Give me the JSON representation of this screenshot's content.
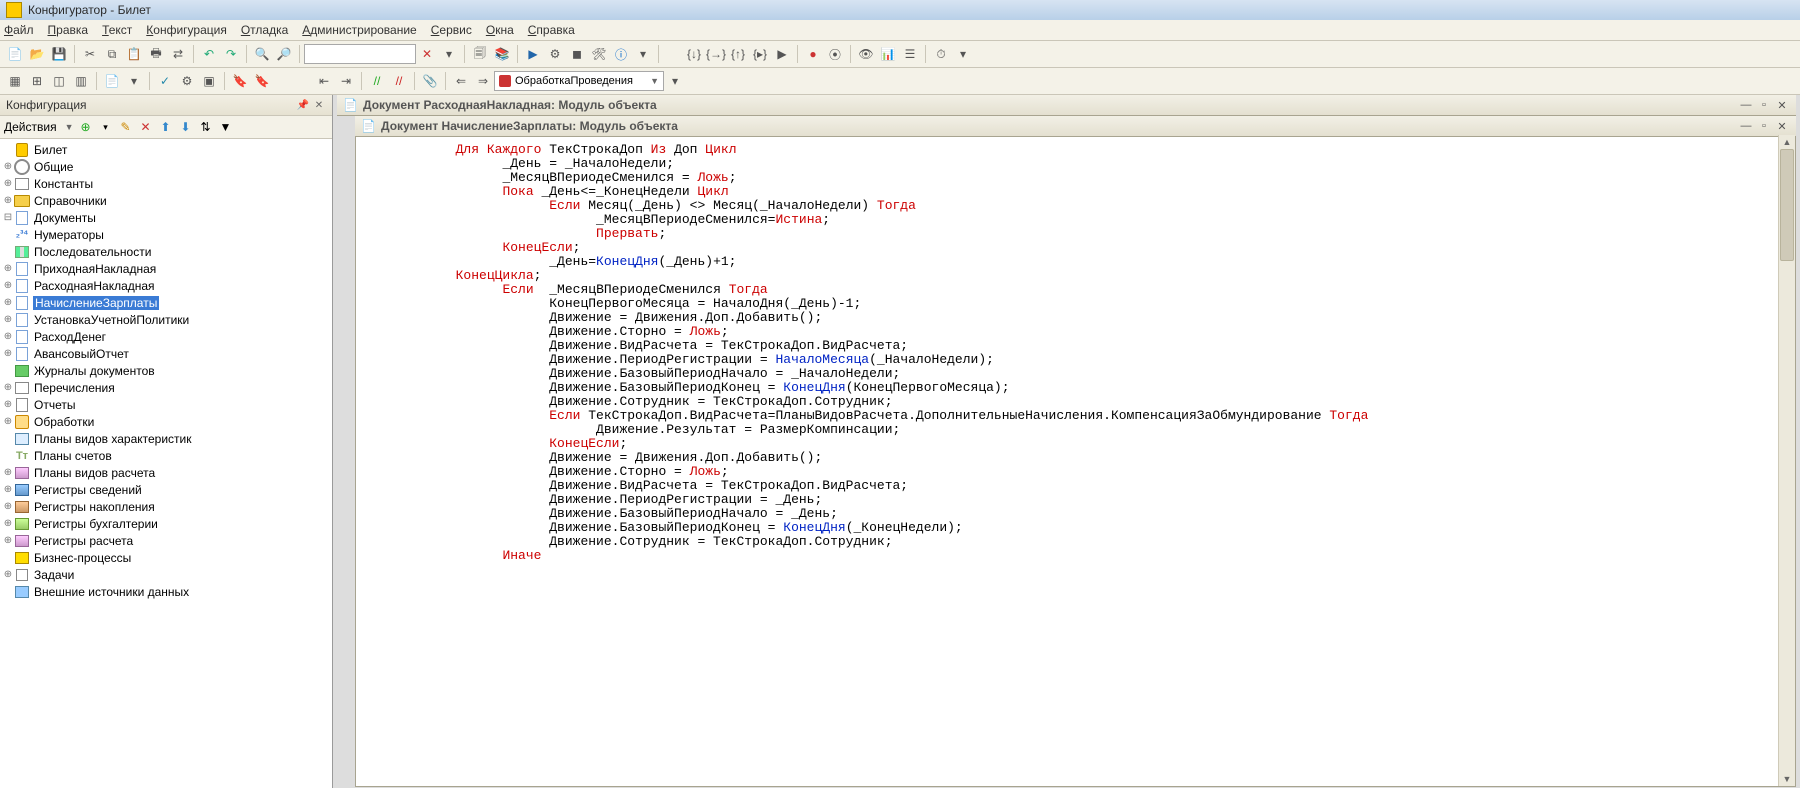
{
  "title": "Конфигуратор - Билет",
  "menu": [
    "Файл",
    "Правка",
    "Текст",
    "Конфигурация",
    "Отладка",
    "Администрирование",
    "Сервис",
    "Окна",
    "Справка"
  ],
  "toolbar2": {
    "combo": "ОбработкаПроведения"
  },
  "side": {
    "header": "Конфигурация",
    "actions": "Действия",
    "tree": [
      {
        "ind": 0,
        "tw": "",
        "ic": "db",
        "lbl": "Билет"
      },
      {
        "ind": 0,
        "tw": "⊕",
        "ic": "gear",
        "lbl": "Общие"
      },
      {
        "ind": 0,
        "tw": "⊕",
        "ic": "enum",
        "lbl": "Константы"
      },
      {
        "ind": 0,
        "tw": "⊕",
        "ic": "folder",
        "lbl": "Справочники"
      },
      {
        "ind": 0,
        "tw": "⊟",
        "ic": "doc",
        "lbl": "Документы"
      },
      {
        "ind": 1,
        "tw": "",
        "ic": "num",
        "lbl": "Нумераторы"
      },
      {
        "ind": 1,
        "tw": "",
        "ic": "seq",
        "lbl": "Последовательности"
      },
      {
        "ind": 1,
        "tw": "⊕",
        "ic": "doc",
        "lbl": "ПриходнаяНакладная"
      },
      {
        "ind": 1,
        "tw": "⊕",
        "ic": "doc",
        "lbl": "РасходнаяНакладная"
      },
      {
        "ind": 1,
        "tw": "⊕",
        "ic": "doc",
        "lbl": "НачислениеЗарплаты",
        "sel": true
      },
      {
        "ind": 1,
        "tw": "⊕",
        "ic": "doc",
        "lbl": "УстановкаУчетнойПолитики"
      },
      {
        "ind": 1,
        "tw": "⊕",
        "ic": "doc",
        "lbl": "РасходДенег"
      },
      {
        "ind": 1,
        "tw": "⊕",
        "ic": "doc",
        "lbl": "АвансовыйОтчет"
      },
      {
        "ind": 0,
        "tw": "",
        "ic": "journal",
        "lbl": "Журналы документов"
      },
      {
        "ind": 0,
        "tw": "⊕",
        "ic": "enum",
        "lbl": "Перечисления"
      },
      {
        "ind": 0,
        "tw": "⊕",
        "ic": "report",
        "lbl": "Отчеты"
      },
      {
        "ind": 0,
        "tw": "⊕",
        "ic": "proc",
        "lbl": "Обработки"
      },
      {
        "ind": 0,
        "tw": "",
        "ic": "plan",
        "lbl": "Планы видов характеристик"
      },
      {
        "ind": 0,
        "tw": "",
        "ic": "acc",
        "lbl": "Планы счетов"
      },
      {
        "ind": 0,
        "tw": "⊕",
        "ic": "regc",
        "lbl": "Планы видов расчета"
      },
      {
        "ind": 0,
        "tw": "⊕",
        "ic": "reg",
        "lbl": "Регистры сведений"
      },
      {
        "ind": 0,
        "tw": "⊕",
        "ic": "rega",
        "lbl": "Регистры накопления"
      },
      {
        "ind": 0,
        "tw": "⊕",
        "ic": "regb",
        "lbl": "Регистры бухгалтерии"
      },
      {
        "ind": 0,
        "tw": "⊕",
        "ic": "regc",
        "lbl": "Регистры расчета"
      },
      {
        "ind": 0,
        "tw": "",
        "ic": "bp",
        "lbl": "Бизнес-процессы"
      },
      {
        "ind": 0,
        "tw": "⊕",
        "ic": "task",
        "lbl": "Задачи"
      },
      {
        "ind": 0,
        "tw": "",
        "ic": "ext",
        "lbl": "Внешние источники данных"
      }
    ]
  },
  "doc1": "Документ РасходнаяНакладная: Модуль объекта",
  "doc2": "Документ НачислениеЗарплаты: Модуль объекта",
  "code": [
    {
      "ind": 2,
      "seg": [
        [
          "red",
          "Для Каждого"
        ],
        [
          "black",
          " ТекСтрокаДоп "
        ],
        [
          "red",
          "Из"
        ],
        [
          "black",
          " Доп "
        ],
        [
          "red",
          "Цикл"
        ]
      ]
    },
    {
      "ind": 0,
      "seg": [
        [
          "black",
          ""
        ]
      ]
    },
    {
      "ind": 3,
      "seg": [
        [
          "black",
          "_День = _НачалоНедели;"
        ]
      ]
    },
    {
      "ind": 3,
      "seg": [
        [
          "black",
          "_МесяцВПериодеСменился = "
        ],
        [
          "red",
          "Ложь"
        ],
        [
          "black",
          ";"
        ]
      ]
    },
    {
      "ind": 0,
      "seg": [
        [
          "black",
          ""
        ]
      ]
    },
    {
      "ind": 3,
      "seg": [
        [
          "red",
          "Пока"
        ],
        [
          "black",
          " _День<=_КонецНедели "
        ],
        [
          "red",
          "Цикл"
        ]
      ]
    },
    {
      "ind": 4,
      "seg": [
        [
          "red",
          "Если"
        ],
        [
          "black",
          " Месяц(_День) <> Месяц(_НачалоНедели) "
        ],
        [
          "red",
          "Тогда"
        ]
      ]
    },
    {
      "ind": 5,
      "seg": [
        [
          "black",
          "_МесяцВПериодеСменился="
        ],
        [
          "red",
          "Истина"
        ],
        [
          "black",
          ";"
        ]
      ]
    },
    {
      "ind": 5,
      "seg": [
        [
          "red",
          "Прервать"
        ],
        [
          "black",
          ";"
        ]
      ]
    },
    {
      "ind": 3,
      "seg": [
        [
          "red",
          "КонецЕсли"
        ],
        [
          "black",
          ";"
        ]
      ]
    },
    {
      "ind": 4,
      "seg": [
        [
          "black",
          "_День="
        ],
        [
          "blue",
          "КонецДня"
        ],
        [
          "black",
          "(_День)+1;"
        ]
      ]
    },
    {
      "ind": 2,
      "seg": [
        [
          "red",
          "КонецЦикла"
        ],
        [
          "black",
          ";"
        ]
      ]
    },
    {
      "ind": 0,
      "seg": [
        [
          "black",
          ""
        ]
      ]
    },
    {
      "ind": 0,
      "seg": [
        [
          "black",
          ""
        ]
      ]
    },
    {
      "ind": 3,
      "seg": [
        [
          "red",
          "Если"
        ],
        [
          "black",
          "  _МесяцВПериодеСменился "
        ],
        [
          "red",
          "Тогда"
        ]
      ]
    },
    {
      "ind": 0,
      "seg": [
        [
          "black",
          ""
        ]
      ]
    },
    {
      "ind": 4,
      "seg": [
        [
          "black",
          "КонецПервогоМесяца = НачалоДня(_День)-1;"
        ]
      ]
    },
    {
      "ind": 0,
      "seg": [
        [
          "black",
          ""
        ]
      ]
    },
    {
      "ind": 4,
      "seg": [
        [
          "black",
          "Движение = Движения.Доп.Добавить();"
        ]
      ]
    },
    {
      "ind": 4,
      "seg": [
        [
          "black",
          "Движение.Сторно = "
        ],
        [
          "red",
          "Ложь"
        ],
        [
          "black",
          ";"
        ]
      ]
    },
    {
      "ind": 4,
      "seg": [
        [
          "black",
          "Движение.ВидРасчета = ТекСтрокаДоп.ВидРасчета;"
        ]
      ]
    },
    {
      "ind": 4,
      "seg": [
        [
          "black",
          "Движение.ПериодРегистрации = "
        ],
        [
          "blue",
          "НачалоМесяца"
        ],
        [
          "black",
          "(_НачалоНедели);"
        ]
      ]
    },
    {
      "ind": 4,
      "seg": [
        [
          "black",
          "Движение.БазовыйПериодНачало = _НачалоНедели;"
        ]
      ]
    },
    {
      "ind": 4,
      "seg": [
        [
          "black",
          "Движение.БазовыйПериодКонец = "
        ],
        [
          "blue",
          "КонецДня"
        ],
        [
          "black",
          "(КонецПервогоМесяца);"
        ]
      ]
    },
    {
      "ind": 4,
      "seg": [
        [
          "black",
          "Движение.Сотрудник = ТекСтрокаДоп.Сотрудник;"
        ]
      ]
    },
    {
      "ind": 0,
      "seg": [
        [
          "black",
          ""
        ]
      ]
    },
    {
      "ind": 4,
      "seg": [
        [
          "red",
          "Если"
        ],
        [
          "black",
          " ТекСтрокаДоп.ВидРасчета=ПланыВидовРасчета.ДополнительныеНачисления.КомпенсацияЗаОбмундирование "
        ],
        [
          "red",
          "Тогда"
        ]
      ]
    },
    {
      "ind": 5,
      "seg": [
        [
          "black",
          "Движение.Результат = РазмерКомпинсации;"
        ]
      ]
    },
    {
      "ind": 4,
      "seg": [
        [
          "red",
          "КонецЕсли"
        ],
        [
          "black",
          ";"
        ]
      ]
    },
    {
      "ind": 0,
      "seg": [
        [
          "black",
          ""
        ]
      ]
    },
    {
      "ind": 0,
      "seg": [
        [
          "black",
          ""
        ]
      ]
    },
    {
      "ind": 4,
      "seg": [
        [
          "black",
          "Движение = Движения.Доп.Добавить();"
        ]
      ]
    },
    {
      "ind": 4,
      "seg": [
        [
          "black",
          "Движение.Сторно = "
        ],
        [
          "red",
          "Ложь"
        ],
        [
          "black",
          ";"
        ]
      ]
    },
    {
      "ind": 4,
      "seg": [
        [
          "black",
          "Движение.ВидРасчета = ТекСтрокаДоп.ВидРасчета;"
        ]
      ]
    },
    {
      "ind": 4,
      "seg": [
        [
          "black",
          "Движение.ПериодРегистрации = _День;"
        ]
      ]
    },
    {
      "ind": 4,
      "seg": [
        [
          "black",
          "Движение.БазовыйПериодНачало = _День;"
        ]
      ]
    },
    {
      "ind": 4,
      "seg": [
        [
          "black",
          "Движение.БазовыйПериодКонец = "
        ],
        [
          "blue",
          "КонецДня"
        ],
        [
          "black",
          "(_КонецНедели);"
        ]
      ]
    },
    {
      "ind": 4,
      "seg": [
        [
          "black",
          "Движение.Сотрудник = ТекСтрокаДоп.Сотрудник;"
        ]
      ]
    },
    {
      "ind": 3,
      "seg": [
        [
          "red",
          "Иначе"
        ]
      ]
    }
  ]
}
